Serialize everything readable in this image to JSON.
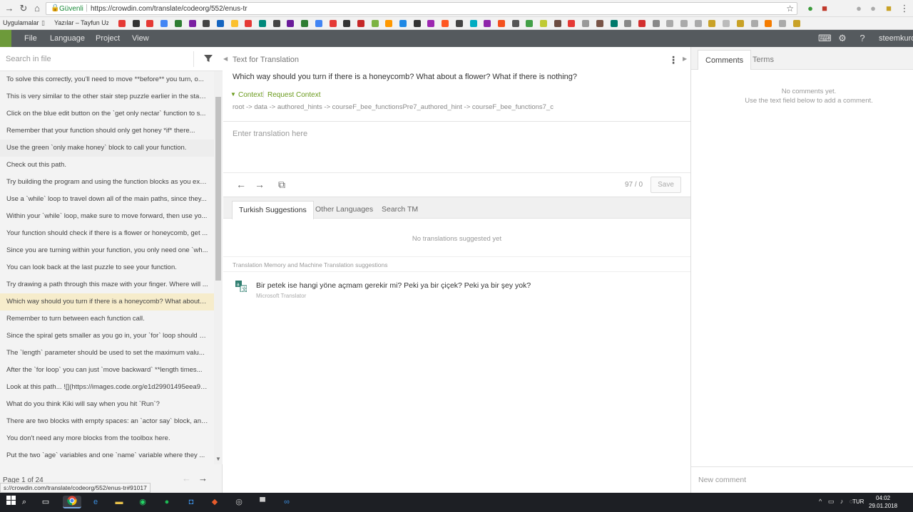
{
  "browser": {
    "secure_label": "Güvenli",
    "url": "https://crowdin.com/translate/codeorg/552/enus-tr",
    "bookmarks_apps": "Uygulamalar",
    "bookmark_item": "Yazılar – Tayfun Uzuk"
  },
  "toolbar": {
    "menu": [
      "File",
      "Language",
      "Project",
      "View"
    ],
    "username": "steemkurd"
  },
  "left": {
    "search_placeholder": "Search in file",
    "strings": [
      "To solve this correctly, you'll need to move **before** you turn, o...",
      "This is very similar to the other stair step puzzle earlier in the stag...",
      "Click on the blue edit button on the `get only nectar` function to s...",
      "Remember that your function should only get honey *if* there...",
      "Use the green `only make honey` block to call your function.",
      "Check out this path.",
      "Try building the program and using the function blocks as you exp...",
      "Use a `while` loop to travel down all of the main paths, since they...",
      "Within your `while` loop, make sure to move forward, then use yo...",
      "Your function should check if there is a flower or honeycomb, get ...",
      "Since you are turning within your function, you only need one `wh...",
      "You can look back at the last puzzle to see your function.",
      "Try drawing a path through this maze with your finger. Where will ...",
      "Which way should you turn if there is a honeycomb? What about a...",
      "Remember to turn between each function call.",
      "Since the spiral gets smaller as you go in, your `for` loop should c...",
      "The `length` parameter should be used to set the maximum valu...",
      "After the `for loop` you can just `move backward` **length times...",
      "Look at this path... ![](https://images.code.org/e1d29901495eea95...",
      "What do you think Kiki will say when you hit `Run`?",
      "There are two blocks with empty spaces: an `actor say` block, and...",
      "You don't need any more blocks from the toolbox here.",
      "Put the two `age` variables and one `name` variable where they ..."
    ],
    "page_info": "Page 1 of 24"
  },
  "center": {
    "heading": "Text for Translation",
    "source_text": "Which way should you turn if there is a honeycomb? What about a flower? What if there is nothing?",
    "context_label": "Context",
    "request_context_label": "Request Context",
    "context_path": "root -> data -> authored_hints -> courseF_bee_functionsPre7_authored_hint -> courseF_bee_functions7_c",
    "translation_placeholder": "Enter translation here",
    "counter": "97 / 0",
    "save_label": "Save",
    "tabs": [
      "Turkish Suggestions",
      "Other Languages",
      "Search TM"
    ],
    "no_translations": "No translations suggested yet",
    "tm_header": "Translation Memory and Machine Translation suggestions",
    "mt_suggestion": "Bir petek ise hangi yöne açmam gerekir mi? Peki ya bir çiçek? Peki ya bir şey yok?",
    "mt_engine": "Microsoft Translator"
  },
  "right": {
    "tabs": [
      "Comments",
      "Terms"
    ],
    "no_comments": "No comments yet.",
    "comments_hint": "Use the text field below to add a comment.",
    "new_comment_placeholder": "New comment"
  },
  "status_url": "s://crowdin.com/translate/codeorg/552/enus-tr#91017",
  "taskbar": {
    "lang": "TUR",
    "time": "04:02",
    "date": "29.01.2018"
  },
  "colors": {
    "accent": "#6a9a1c",
    "toolbar_bg": "#555a5e",
    "selected_row": "#f6eccb"
  }
}
